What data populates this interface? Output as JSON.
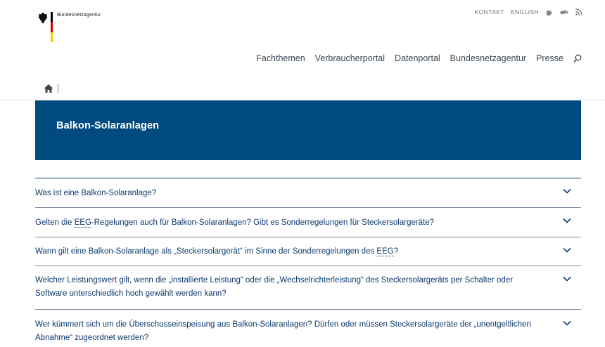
{
  "header": {
    "logo_text": "Bundesnetzagentur",
    "meta_links": {
      "contact": "KONTAKT",
      "english": "ENGLISH"
    },
    "nav": [
      "Fachthemen",
      "Verbraucherportal",
      "Datenportal",
      "Bundesnetzagentur",
      "Presse"
    ]
  },
  "hero": {
    "title": "Balkon-Solaranlagen"
  },
  "faq": {
    "items": [
      {
        "parts": [
          "Was ist eine Balkon-Solaranlage?"
        ]
      },
      {
        "parts": [
          "Gelten die ",
          "EEG",
          "-Regelungen auch für Balkon-Solaranlagen? Gibt es Sonderregelungen für Steckersolargeräte?"
        ]
      },
      {
        "parts": [
          "Wann gilt eine Balkon-Solaranlage als „Steckersolargerät“ im Sinne der Sonderregelungen des ",
          "EEG",
          "?"
        ]
      },
      {
        "parts": [
          "Welcher Leistungswert gilt, wenn die „installierte Leistung“ oder die „Wechselrichterleistung“ des Steckersolargeräts per Schalter oder Software unterschiedlich hoch gewählt werden kann?"
        ]
      },
      {
        "parts": [
          "Wer kümmert sich um die Überschusseinspeisung aus Balkon-Solaranlagen? Dürfen oder müssen Steckersolargeräte der „unentgeltlichen Abnahme“ zugeordnet werden?"
        ]
      }
    ]
  },
  "colors": {
    "brand_blue": "#004a7f",
    "text_blue": "#0d3a6b",
    "flag": [
      "#000000",
      "#dd0000",
      "#ffcc00"
    ]
  }
}
